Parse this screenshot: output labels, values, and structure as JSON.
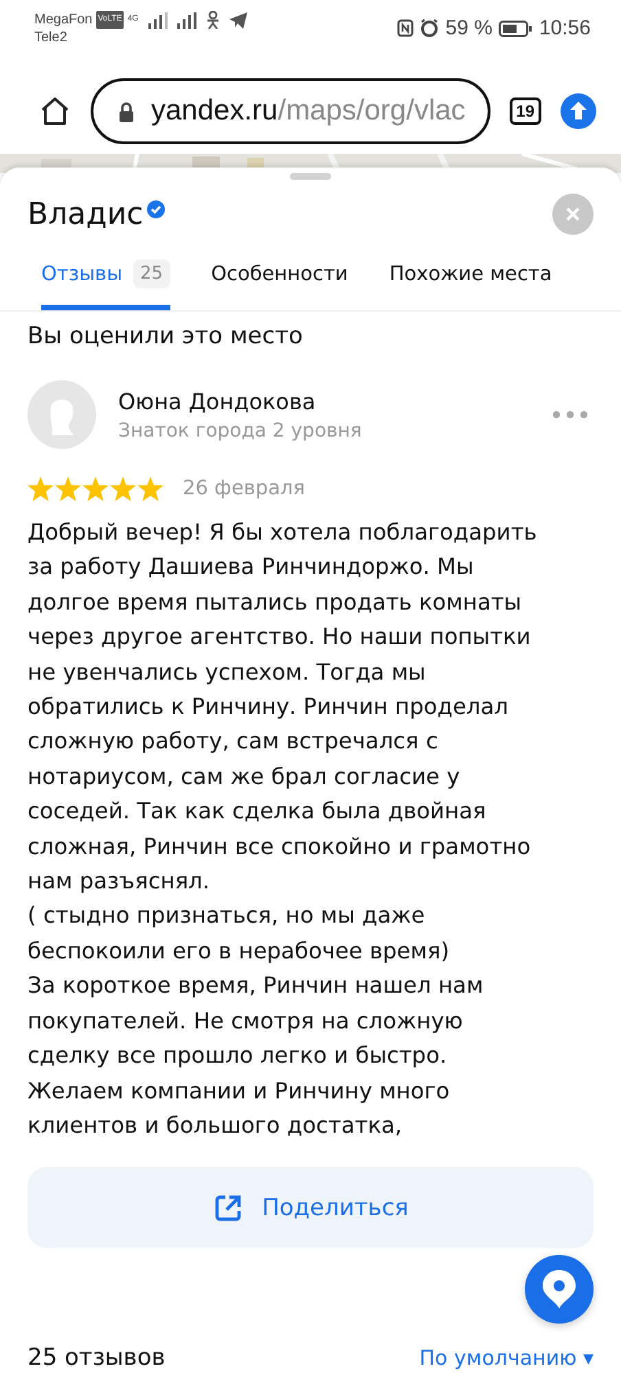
{
  "status_bar": {
    "carrier_1": "MegaFon",
    "volte": "VoLTE",
    "carrier_2": "Tele2",
    "network": "4G",
    "battery": "59 %",
    "time": "10:56"
  },
  "browser": {
    "url_host": "yandex.ru",
    "url_path": "/maps/org/vlac",
    "tabs_count": "19"
  },
  "place": {
    "title": "Владис",
    "verified": true
  },
  "tabs": [
    {
      "label": "Отзывы",
      "count": "25",
      "selected": true
    },
    {
      "label": "Особенности",
      "selected": false
    },
    {
      "label": "Похожие места",
      "selected": false
    }
  ],
  "rated_heading": "Вы оценили это место",
  "review": {
    "author": "Оюна Дондокова",
    "level": "Знаток города 2 уровня",
    "stars": 5,
    "date": "26 февраля",
    "lines": [
      "Добрый вечер! Я бы хотела поблагодарить",
      "за работу Дашиева Ринчиндоржо. Мы",
      "долгое время пытались продать комнаты",
      "через другое агентство. Но наши попытки",
      "не увенчались успехом. Тогда мы",
      "обратились к Ринчину. Ринчин проделал",
      "сложную работу, сам встречался с",
      "нотариусом, сам же брал согласие у",
      "соседей. Так как сделка была двойная",
      "сложная, Ринчин все спокойно и грамотно",
      "нам разъяснял.",
      "( стыдно признаться, но мы даже",
      "беспокоили его в нерабочее время)",
      "За короткое время, Ринчин нашел нам",
      "покупателей. Не смотря на сложную",
      "сделку все прошло легко и быстро.",
      "Желаем компании и Ринчину много",
      "клиентов и большого достатка,"
    ]
  },
  "share_button": "Поделиться",
  "reviews_count": "25 отзывов",
  "sort": {
    "label": "По умолчанию",
    "caret": "▾"
  }
}
